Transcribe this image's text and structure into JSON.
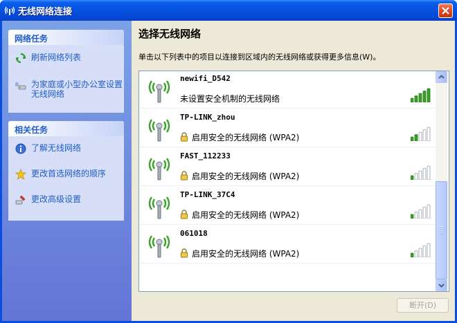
{
  "window": {
    "title": "无线网络连接"
  },
  "sidebar": {
    "network_tasks": {
      "header": "网络任务",
      "items": [
        {
          "label": "刷新网络列表",
          "icon": "refresh-icon"
        },
        {
          "label": "为家庭或小型办公室设置无线网络",
          "icon": "wireless-setup-icon"
        }
      ]
    },
    "related_tasks": {
      "header": "相关任务",
      "items": [
        {
          "label": "了解无线网络",
          "icon": "info-icon"
        },
        {
          "label": "更改首选网络的顺序",
          "icon": "star-icon"
        },
        {
          "label": "更改高级设置",
          "icon": "settings-icon"
        }
      ]
    }
  },
  "main": {
    "title": "选择无线网络",
    "description": "单击以下列表中的项目以连接到区域内的无线网络或获得更多信息(W)。",
    "networks": [
      {
        "ssid": "newifi_D542",
        "status": "未设置安全机制的无线网络",
        "secured": false,
        "signal_bars": 5
      },
      {
        "ssid": "TP-LINK_zhou",
        "status": "启用安全的无线网络 (WPA2)",
        "secured": true,
        "signal_bars": 2
      },
      {
        "ssid": "FAST_112233",
        "status": "启用安全的无线网络 (WPA2)",
        "secured": true,
        "signal_bars": 1
      },
      {
        "ssid": "TP-LINK_37C4",
        "status": "启用安全的无线网络 (WPA2)",
        "secured": true,
        "signal_bars": 1
      },
      {
        "ssid": "061018",
        "status": "启用安全的无线网络 (WPA2)",
        "secured": true,
        "signal_bars": 1
      }
    ],
    "disconnect_label": "断开(D)"
  },
  "colors": {
    "titlebar": "#0551e0",
    "sidebar": "#6f8ce0",
    "task_link": "#215dc6",
    "signal_on": "#3aa02a",
    "signal_off": "#9aa0a6"
  }
}
